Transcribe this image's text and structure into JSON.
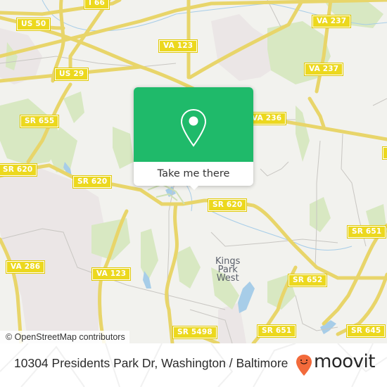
{
  "map": {
    "road_labels": [
      {
        "id": "i66",
        "text": "I 66"
      },
      {
        "id": "us50",
        "text": "US 50"
      },
      {
        "id": "us29",
        "text": "US 29"
      },
      {
        "id": "va123-top",
        "text": "VA 123"
      },
      {
        "id": "va237-top",
        "text": "VA 237"
      },
      {
        "id": "va237-mid",
        "text": "VA 237"
      },
      {
        "id": "va236",
        "text": "VA 236"
      },
      {
        "id": "sr655",
        "text": "SR 655"
      },
      {
        "id": "sr620-left",
        "text": "SR 620"
      },
      {
        "id": "sr620-mid",
        "text": "SR 620"
      },
      {
        "id": "sr620-right",
        "text": "SR 620"
      },
      {
        "id": "sr651-right",
        "text": "SR 651"
      },
      {
        "id": "va286",
        "text": "VA 286"
      },
      {
        "id": "va123-bottom",
        "text": "VA 123"
      },
      {
        "id": "sr652",
        "text": "SR 652"
      },
      {
        "id": "sr5498",
        "text": "SR 5498"
      },
      {
        "id": "sr651-bottom",
        "text": "SR 651"
      },
      {
        "id": "sr645",
        "text": "SR 645"
      },
      {
        "id": "edge-partial",
        "text": "SR"
      }
    ],
    "place_label": [
      "Kings",
      "Park",
      "West"
    ],
    "attribution": "© OpenStreetMap contributors"
  },
  "popup": {
    "icon": "map-pin-icon",
    "button_label": "Take me there",
    "accent_color": "#1fba6a"
  },
  "footer": {
    "address": "10304 Presidents Park Dr, Washington / Baltimore",
    "brand": "moovit",
    "brand_icon": "moovit-smiley-pin-icon",
    "brand_color": "#f26a3b"
  }
}
